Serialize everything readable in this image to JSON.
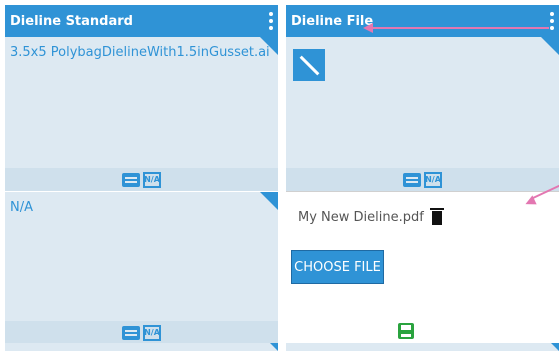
{
  "columns": [
    {
      "header": "Dieline Standard",
      "rows": [
        {
          "text": "3.5x5 PolybagDielineWith1.5inGusset.ai"
        },
        {
          "text": "N/A"
        }
      ]
    },
    {
      "header": "Dieline File",
      "rows": [
        {
          "text": ""
        },
        {
          "file_name": "My New Dieline.pdf",
          "button_label": "CHOOSE FILE"
        }
      ]
    }
  ],
  "icons": {
    "na_label": "N/A",
    "kebab": "kebab-menu-icon",
    "note": "note-icon",
    "na": "na-icon",
    "image": "no-image-icon",
    "trash": "trash-icon",
    "save": "save-icon"
  },
  "colors": {
    "header_bg": "#2f93d6",
    "cell_bg": "#dde9f2",
    "annotation": "#e377b1",
    "save_green": "#2aa33f"
  }
}
